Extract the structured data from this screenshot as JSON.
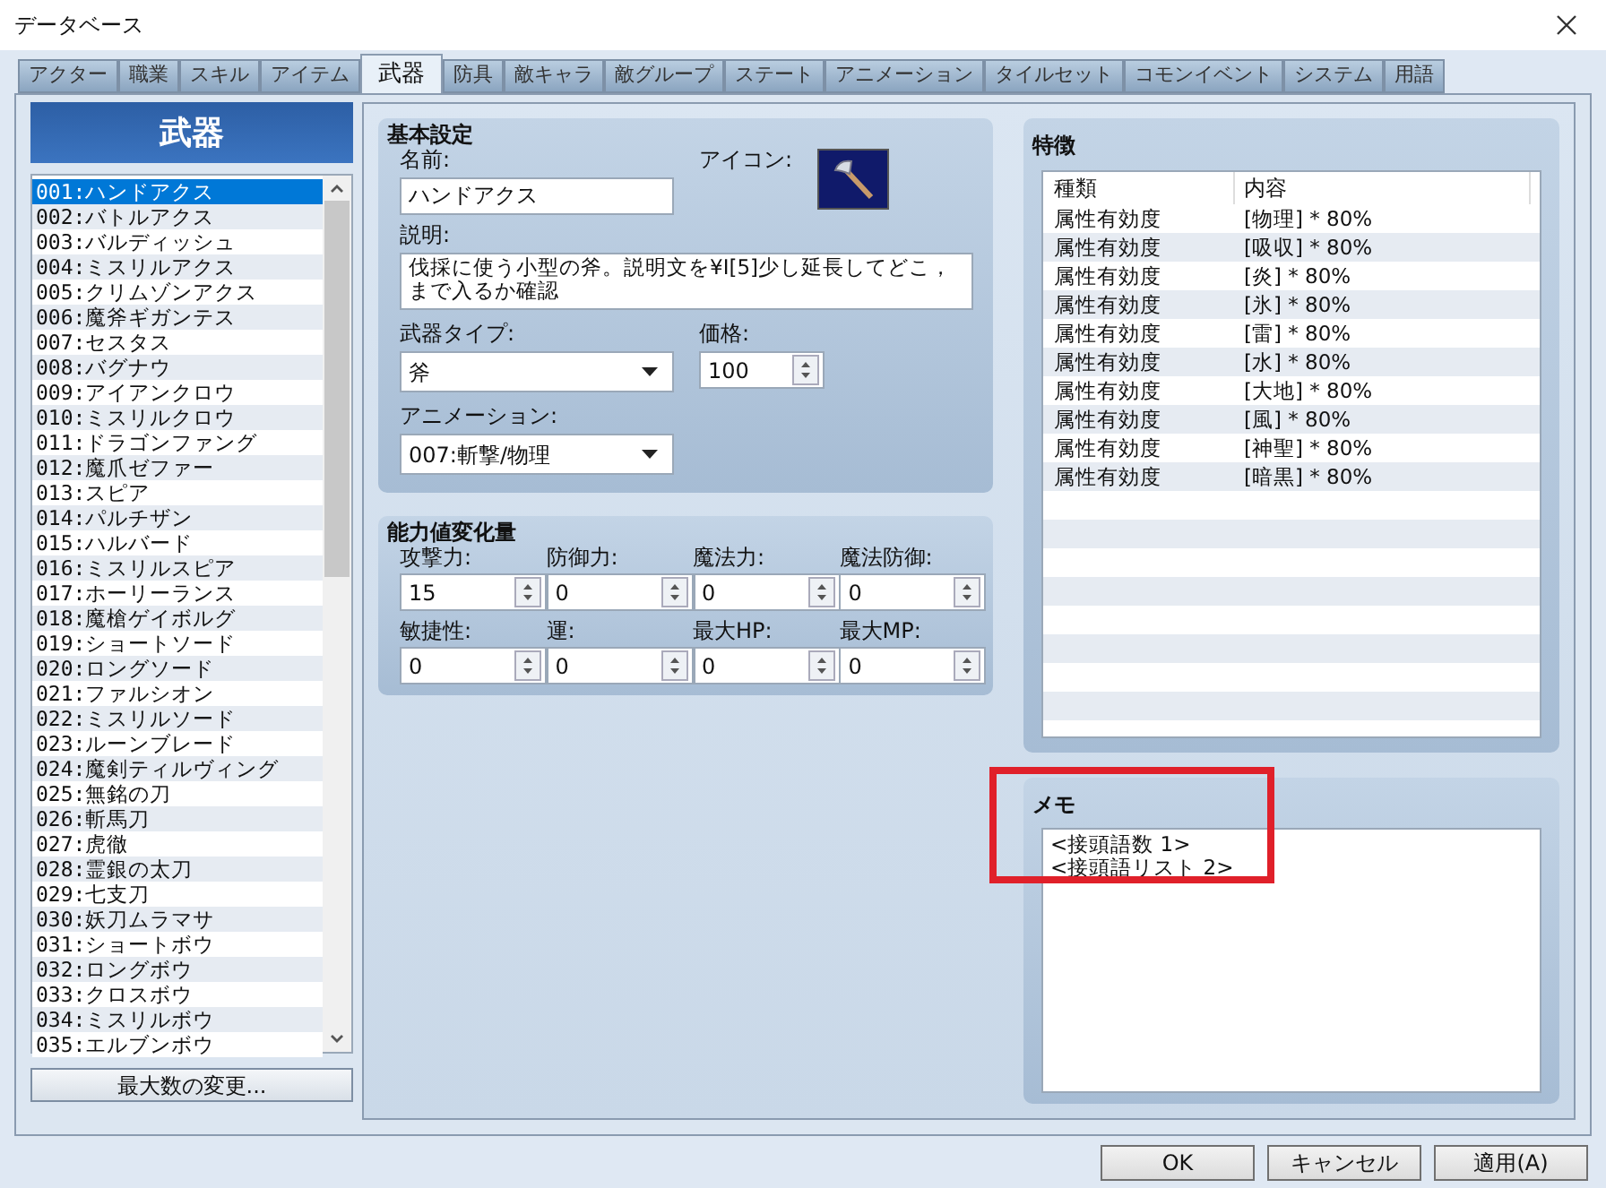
{
  "window": {
    "title": "データベース"
  },
  "tabs": [
    {
      "label": "アクター",
      "selected": false
    },
    {
      "label": "職業",
      "selected": false
    },
    {
      "label": "スキル",
      "selected": false
    },
    {
      "label": "アイテム",
      "selected": false
    },
    {
      "label": "武器",
      "selected": true
    },
    {
      "label": "防具",
      "selected": false
    },
    {
      "label": "敵キャラ",
      "selected": false
    },
    {
      "label": "敵グループ",
      "selected": false
    },
    {
      "label": "ステート",
      "selected": false
    },
    {
      "label": "アニメーション",
      "selected": false
    },
    {
      "label": "タイルセット",
      "selected": false
    },
    {
      "label": "コモンイベント",
      "selected": false
    },
    {
      "label": "システム",
      "selected": false
    },
    {
      "label": "用語",
      "selected": false
    }
  ],
  "sidebar": {
    "header": "武器",
    "items": [
      {
        "label": "001:ハンドアクス",
        "selected": true
      },
      {
        "label": "002:バトルアクス",
        "selected": false
      },
      {
        "label": "003:バルディッシュ",
        "selected": false
      },
      {
        "label": "004:ミスリルアクス",
        "selected": false
      },
      {
        "label": "005:クリムゾンアクス",
        "selected": false
      },
      {
        "label": "006:魔斧ギガンテス",
        "selected": false
      },
      {
        "label": "007:セスタス",
        "selected": false
      },
      {
        "label": "008:バグナウ",
        "selected": false
      },
      {
        "label": "009:アイアンクロウ",
        "selected": false
      },
      {
        "label": "010:ミスリルクロウ",
        "selected": false
      },
      {
        "label": "011:ドラゴンファング",
        "selected": false
      },
      {
        "label": "012:魔爪ゼファー",
        "selected": false
      },
      {
        "label": "013:スピア",
        "selected": false
      },
      {
        "label": "014:パルチザン",
        "selected": false
      },
      {
        "label": "015:ハルバード",
        "selected": false
      },
      {
        "label": "016:ミスリルスピア",
        "selected": false
      },
      {
        "label": "017:ホーリーランス",
        "selected": false
      },
      {
        "label": "018:魔槍ゲイボルグ",
        "selected": false
      },
      {
        "label": "019:ショートソード",
        "selected": false
      },
      {
        "label": "020:ロングソード",
        "selected": false
      },
      {
        "label": "021:ファルシオン",
        "selected": false
      },
      {
        "label": "022:ミスリルソード",
        "selected": false
      },
      {
        "label": "023:ルーンブレード",
        "selected": false
      },
      {
        "label": "024:魔剣ティルヴィング",
        "selected": false
      },
      {
        "label": "025:無銘の刀",
        "selected": false
      },
      {
        "label": "026:斬馬刀",
        "selected": false
      },
      {
        "label": "027:虎徹",
        "selected": false
      },
      {
        "label": "028:霊銀の太刀",
        "selected": false
      },
      {
        "label": "029:七支刀",
        "selected": false
      },
      {
        "label": "030:妖刀ムラマサ",
        "selected": false
      },
      {
        "label": "031:ショートボウ",
        "selected": false
      },
      {
        "label": "032:ロングボウ",
        "selected": false
      },
      {
        "label": "033:クロスボウ",
        "selected": false
      },
      {
        "label": "034:ミスリルボウ",
        "selected": false
      },
      {
        "label": "035:エルブンボウ",
        "selected": false
      }
    ],
    "button": "最大数の変更..."
  },
  "basic": {
    "title": "基本設定",
    "name_label": "名前:",
    "name": "ハンドアクス",
    "icon_label": "アイコン:",
    "description_label": "説明:",
    "description": "伐採に使う小型の斧。説明文を¥I[5]少し延長してどこ，まで入るか確認",
    "type_label": "武器タイプ:",
    "type": "斧",
    "price_label": "価格:",
    "price": "100",
    "animation_label": "アニメーション:",
    "animation": "007:斬撃/物理"
  },
  "params": {
    "title": "能力値変化量",
    "fields": [
      {
        "label": "攻撃力:",
        "value": "15"
      },
      {
        "label": "防御力:",
        "value": "0"
      },
      {
        "label": "魔法力:",
        "value": "0"
      },
      {
        "label": "魔法防御:",
        "value": "0"
      },
      {
        "label": "敏捷性:",
        "value": "0"
      },
      {
        "label": "運:",
        "value": "0"
      },
      {
        "label": "最大HP:",
        "value": "0"
      },
      {
        "label": "最大MP:",
        "value": "0"
      }
    ]
  },
  "features": {
    "title": "特徴",
    "columns": [
      "種類",
      "内容"
    ],
    "rows": [
      [
        "属性有効度",
        "[物理] * 80%"
      ],
      [
        "属性有効度",
        "[吸収] * 80%"
      ],
      [
        "属性有効度",
        "[炎] * 80%"
      ],
      [
        "属性有効度",
        "[氷] * 80%"
      ],
      [
        "属性有効度",
        "[雷] * 80%"
      ],
      [
        "属性有効度",
        "[水] * 80%"
      ],
      [
        "属性有効度",
        "[大地] * 80%"
      ],
      [
        "属性有効度",
        "[風] * 80%"
      ],
      [
        "属性有効度",
        "[神聖] * 80%"
      ],
      [
        "属性有効度",
        "[暗黒] * 80%"
      ]
    ]
  },
  "memo": {
    "title": "メモ",
    "text": "<接頭語数 1>\n<接頭語リスト 2>"
  },
  "buttons": [
    "OK",
    "キャンセル",
    "適用(A)"
  ]
}
